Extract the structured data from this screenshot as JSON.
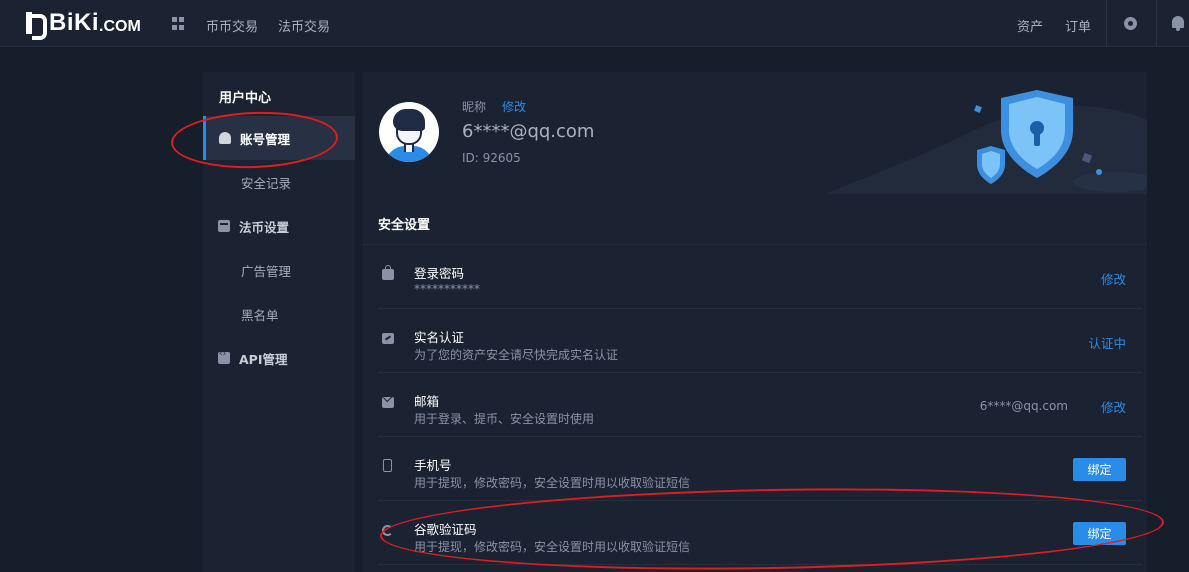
{
  "brand": {
    "logo_text": "BiKi",
    "logo_suffix": ".COM"
  },
  "topnav": {
    "links": [
      "币币交易",
      "法币交易"
    ],
    "right_links": [
      "资产",
      "订单"
    ],
    "icons": [
      "apps-grid-icon",
      "gear-icon",
      "bell-icon"
    ]
  },
  "sidebar": {
    "title": "用户中心",
    "items": [
      {
        "label": "账号管理",
        "icon": "user-icon",
        "active": true
      },
      {
        "label": "安全记录",
        "icon": null,
        "active": false
      },
      {
        "label": "法币设置",
        "icon": "card-icon",
        "active": false
      },
      {
        "label": "广告管理",
        "icon": null,
        "active": false
      },
      {
        "label": "黑名单",
        "icon": null,
        "active": false
      },
      {
        "label": "API管理",
        "icon": "api-icon",
        "active": false
      }
    ]
  },
  "profile": {
    "nickname_label": "昵称",
    "nickname_edit": "修改",
    "email": "6****@qq.com",
    "uid": "ID: 92605"
  },
  "security": {
    "title": "安全设置",
    "rows": [
      {
        "title": "登录密码",
        "desc": "***********",
        "value": "",
        "action": "修改",
        "action_type": "link",
        "icon": "lock-icon"
      },
      {
        "title": "实名认证",
        "desc": "为了您的资产安全请尽快完成实名认证",
        "value": "",
        "action": "认证中",
        "action_type": "link",
        "icon": "id-card-icon"
      },
      {
        "title": "邮箱",
        "desc": "用于登录、提币、安全设置时使用",
        "value": "6****@qq.com",
        "action": "修改",
        "action_type": "link",
        "icon": "mail-icon"
      },
      {
        "title": "手机号",
        "desc": "用于提现，修改密码，安全设置时用以收取验证短信",
        "value": "",
        "action": "绑定",
        "action_type": "button",
        "icon": "phone-icon"
      },
      {
        "title": "谷歌验证码",
        "desc": "用于提现，修改密码，安全设置时用以收取验证短信",
        "value": "",
        "action": "绑定",
        "action_type": "button",
        "icon": "google-auth-icon"
      }
    ]
  },
  "colors": {
    "accent": "#2b8ce8",
    "page_bg": "#161d2b",
    "panel_bg": "#1b2332",
    "annotation": "#e01d1d"
  }
}
